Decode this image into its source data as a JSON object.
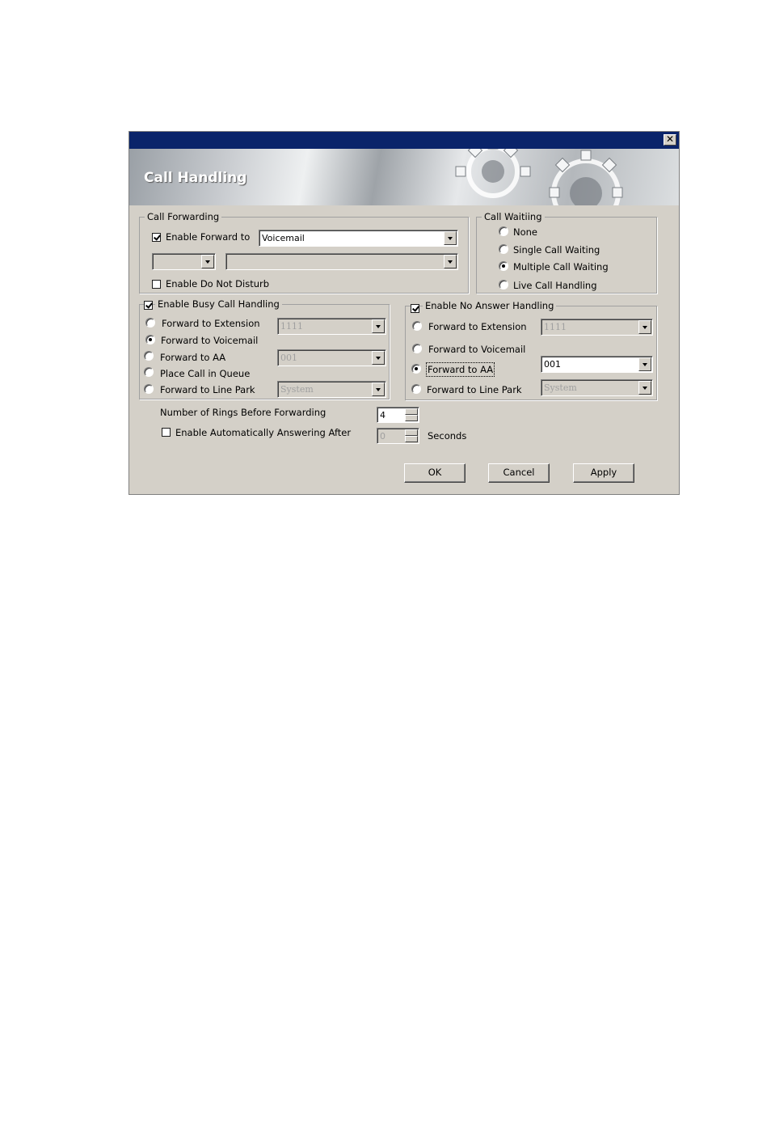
{
  "window": {
    "title": "Call Handling",
    "close_glyph": "✕"
  },
  "call_forwarding": {
    "legend": "Call Forwarding",
    "enable_forward_label": "Enable Forward to",
    "enable_forward_checked": true,
    "forward_to_value": "Voicemail",
    "small_combo_value": "",
    "wide_combo_value": "",
    "dnd_label": "Enable Do Not Disturb",
    "dnd_checked": false
  },
  "call_waiting": {
    "legend": "Call Waitiing",
    "options": [
      "None",
      "Single Call Waiting",
      "Multiple Call Waiting",
      "Live Call Handling"
    ],
    "selected": "Multiple Call Waiting"
  },
  "busy": {
    "legend": "Enable Busy Call Handling",
    "checked": true,
    "options": [
      "Forward to Extension",
      "Forward to Voicemail",
      "Forward to AA",
      "Place Call in Queue",
      "Forward to Line Park"
    ],
    "selected": "Forward to Voicemail",
    "extension_value": "1111",
    "aa_value": "001",
    "line_park_value": "System"
  },
  "no_answer": {
    "legend": "Enable No Answer Handling",
    "checked": true,
    "options": [
      "Forward to Extension",
      "Forward to Voicemail",
      "Forward to AA",
      "Forward to Line Park"
    ],
    "selected": "Forward to AA",
    "extension_value": "1111",
    "aa_value": "001",
    "line_park_value": "System"
  },
  "rings": {
    "label": "Number of Rings Before Forwarding",
    "value": "4"
  },
  "auto_answer": {
    "label": "Enable Automatically Answering After",
    "checked": false,
    "value": "0",
    "unit": "Seconds"
  },
  "buttons": {
    "ok": "OK",
    "cancel": "Cancel",
    "apply": "Apply"
  }
}
